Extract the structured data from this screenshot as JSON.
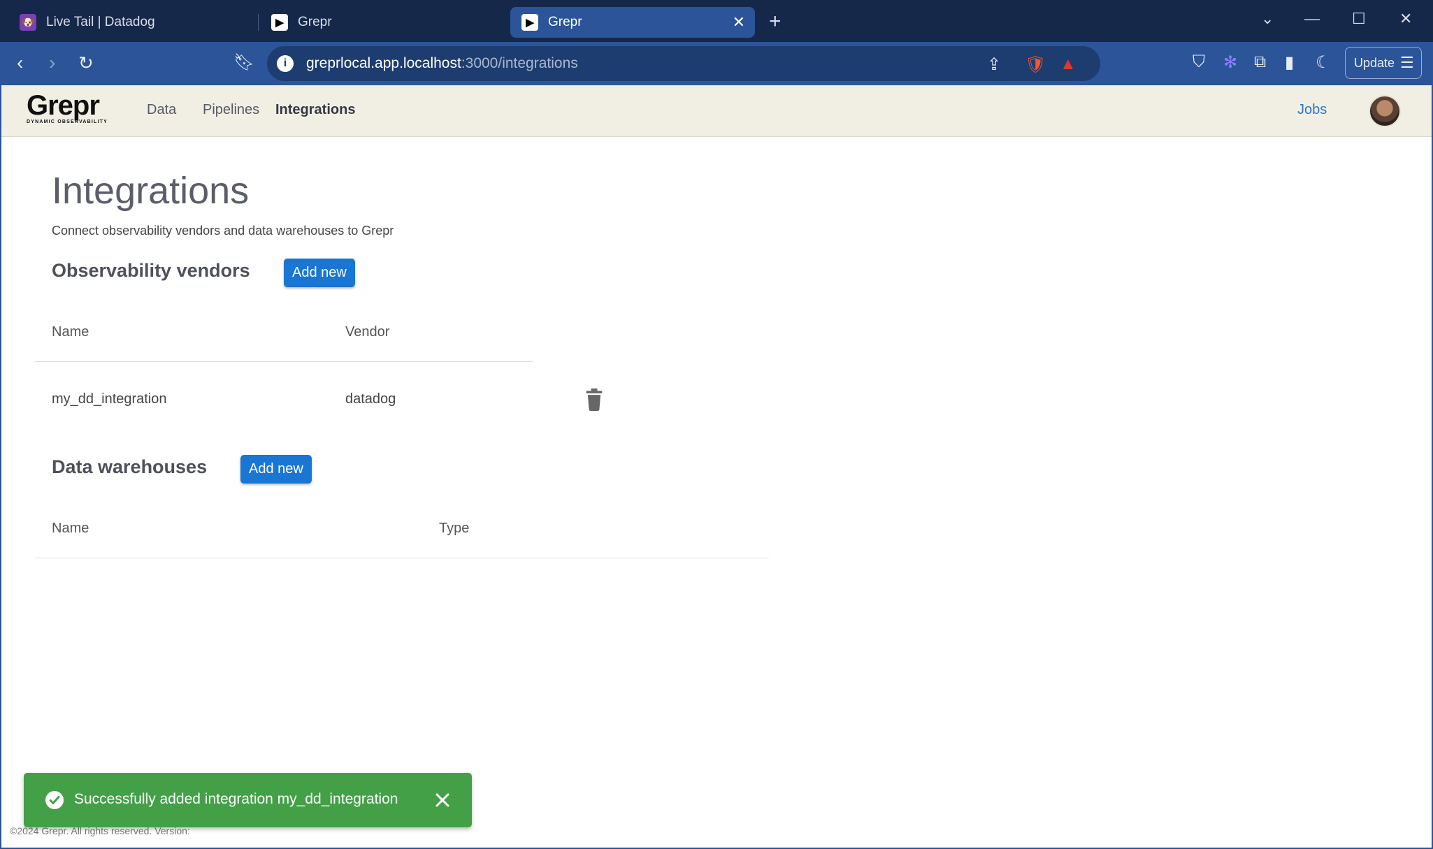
{
  "browser": {
    "tabs": [
      {
        "title": "Live Tail | Datadog",
        "active": false
      },
      {
        "title": "Grepr",
        "active": false
      },
      {
        "title": "Grepr",
        "active": true
      }
    ],
    "url_host": "greprlocal.app.localhost",
    "url_path": ":3000/integrations",
    "update_label": "Update"
  },
  "app": {
    "logo": {
      "word": "Grepr",
      "tagline": "DYNAMIC OBSERVABILITY"
    },
    "nav": [
      {
        "label": "Data",
        "active": false
      },
      {
        "label": "Pipelines",
        "active": false
      },
      {
        "label": "Integrations",
        "active": true
      }
    ],
    "jobs_label": "Jobs"
  },
  "page": {
    "title": "Integrations",
    "subtitle": "Connect observability vendors and data warehouses to Grepr",
    "vendors": {
      "heading": "Observability vendors",
      "add_label": "Add new",
      "columns": [
        "Name",
        "Vendor"
      ],
      "rows": [
        {
          "name": "my_dd_integration",
          "vendor": "datadog"
        }
      ]
    },
    "warehouses": {
      "heading": "Data warehouses",
      "add_label": "Add new",
      "columns": [
        "Name",
        "Type"
      ],
      "rows": []
    }
  },
  "toast": {
    "message": "Successfully added integration my_dd_integration",
    "color": "#43a047"
  },
  "footer": {
    "text": "©2024 Grepr. All rights reserved.   Version:"
  },
  "colors": {
    "accent": "#1976d2",
    "nav_bg": "#f1efe4",
    "browser_chrome": "#2b5499"
  }
}
